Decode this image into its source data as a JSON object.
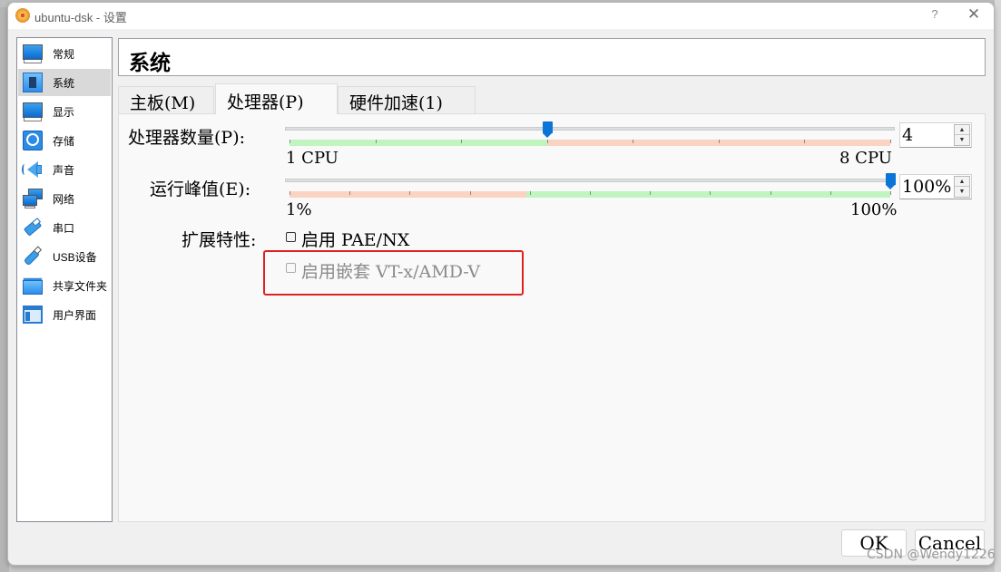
{
  "window": {
    "title": "ubuntu-dsk - 设置",
    "help_label": "?",
    "close_label": "✕"
  },
  "sidebar": {
    "items": [
      {
        "label": "常规",
        "icon": "monitor-icon",
        "selected": false
      },
      {
        "label": "系统",
        "icon": "chip-icon",
        "selected": true
      },
      {
        "label": "显示",
        "icon": "display-icon",
        "selected": false
      },
      {
        "label": "存储",
        "icon": "storage-icon",
        "selected": false
      },
      {
        "label": "声音",
        "icon": "speaker-icon",
        "selected": false
      },
      {
        "label": "网络",
        "icon": "network-icon",
        "selected": false
      },
      {
        "label": "串口",
        "icon": "serial-port-icon",
        "selected": false
      },
      {
        "label": "USB设备",
        "icon": "usb-icon",
        "selected": false
      },
      {
        "label": "共享文件夹",
        "icon": "shared-folder-icon",
        "selected": false
      },
      {
        "label": "用户界面",
        "icon": "user-interface-icon",
        "selected": false
      }
    ]
  },
  "header": {
    "title": "系统"
  },
  "tabs": [
    {
      "label": "主板(M)",
      "active": false
    },
    {
      "label": "处理器(P)",
      "active": true
    },
    {
      "label": "硬件加速(1)",
      "active": false
    }
  ],
  "processor": {
    "cpu_count": {
      "label": "处理器数量(P):",
      "min_label": "1 CPU",
      "max_label": "8 CPU",
      "min": 1,
      "max": 8,
      "value": 4,
      "spin_value": "4",
      "safe_max": 4
    },
    "execution_cap": {
      "label": "运行峰值(E):",
      "min_label": "1%",
      "max_label": "100%",
      "min": 1,
      "max": 100,
      "value": 100,
      "spin_value": "100%",
      "warn_below": 40
    },
    "extended_features": {
      "label": "扩展特性:",
      "pae_nx": {
        "label": "启用 PAE/NX",
        "checked": false,
        "enabled": true
      },
      "nested_vtx": {
        "label": "启用嵌套 VT-x/AMD-V",
        "checked": false,
        "enabled": false
      }
    }
  },
  "colors": {
    "safe": "#c0f5c0",
    "warn": "#fbd3c2",
    "handle": "#0a74d9",
    "highlight": "#e02020"
  },
  "buttons": {
    "ok": "OK",
    "cancel": "Cancel"
  },
  "watermark": "CSDN @Wendy1226"
}
